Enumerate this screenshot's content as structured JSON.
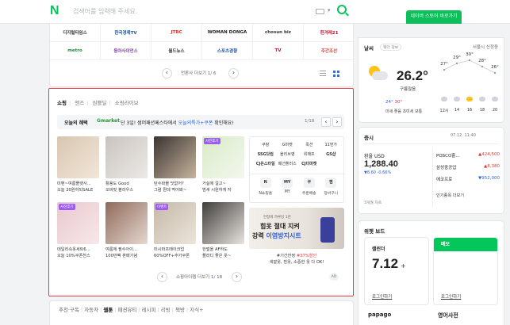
{
  "topbar": {
    "logo": "N",
    "search_placeholder": "검색어를 입력해 주세요.",
    "promo_label": "네이버 스토어 바로가기"
  },
  "press": {
    "rows": [
      [
        "디지털타임스",
        "한국경제TV",
        "JTBC",
        "WOMAN DONGA",
        "chosun biz",
        "한겨레21"
      ],
      [
        "metro",
        "동아사이언스",
        "월드뉴스",
        "스포츠경향",
        "TV",
        "주간조선"
      ]
    ],
    "pager_label": "언론사 더보기",
    "pager_page": "1",
    "pager_total": "/ 6"
  },
  "shopping": {
    "tabs": [
      "쇼핑",
      "맨즈",
      "원쁠딜",
      "쇼핑라이브"
    ],
    "benefit": {
      "label": "오늘의 혜택",
      "brand_prefix": "G",
      "brand": "market",
      "message_pre": "단 3일! 썸머패션페스타에서 ",
      "message_hl": "오늘의특가+쿠폰",
      "message_post": " 확인해요!",
      "counter": "1/18"
    },
    "products": [
      {
        "l1": "미밴~여름플랫사...",
        "l2": "오늘 20원하되SALE",
        "tag": "",
        "c1": "#d9c6b0",
        "c2": "#f1e6da"
      },
      {
        "l1": "활용도 Good",
        "l2": "오버핏 블라우스",
        "tag": "",
        "c1": "#c9c4bf",
        "c2": "#ece9e6"
      },
      {
        "l1": "탄수화물 맛없어?",
        "l2": "그럼 뭔데 먹어봐~",
        "tag": "",
        "c1": "#3a3431",
        "c2": "#c7b49e"
      },
      {
        "l1": "거실에 걸고~",
        "l2": "범새 시원하게 자",
        "tag": "사진후기",
        "c1": "#d8ebc7",
        "c2": "#f4f7ee"
      },
      {
        "l1": "데일리속옷세트6...",
        "l2": "오늘 10%쿠폰찬스",
        "tag": "사진후기",
        "c1": "#e9c8cd",
        "c2": "#f7e8ea"
      },
      {
        "l1": "여름에 필수아이...",
        "l2": "100만팩 판매기념",
        "tag": "",
        "c1": "#8f6a5a",
        "c2": "#e5d8d0"
      },
      {
        "l1": "미시퍼프메이크업",
        "l2": "60%OFF+추가쿠폰",
        "tag": "이벤트",
        "c1": "#c4b8a8",
        "c2": "#ece5db"
      },
      {
        "l1": "한벌을 AF하도",
        "l2": "플라디 좋은 옷~",
        "tag": "",
        "c1": "#3f3d3b",
        "c2": "#e8e4df"
      }
    ],
    "keywords": [
      "쿠팡",
      "G마켓",
      "옥션",
      "11번가",
      "SSG닷컴",
      "올리브영",
      "위메프",
      "GS샵",
      "CJ온스타일",
      "패션플러스",
      "CJ더마켓",
      ""
    ],
    "services": [
      {
        "icon": "N",
        "label": "N쇼핑홈"
      },
      {
        "icon": "MY",
        "label": "MY"
      },
      {
        "icon": "쿠",
        "label": "주문배송"
      },
      {
        "icon": "찜",
        "label": "장바구니"
      }
    ],
    "ad": {
      "small": "한정에 하루당 1번",
      "headline1": "힘옷 절대 지켜",
      "headline2_pre": "강력 ",
      "headline2_hl": "이염방지시트",
      "cap1_pre": "#기간한정 ",
      "cap1_hl": "#37%할인",
      "cap2": "색깔옷, 흰옷, 소중한 옷 다 OK!"
    },
    "pager_label": "쇼핑아이템 더보기",
    "pager_page": "1",
    "pager_total": "/ 18",
    "ad_badge": "AD"
  },
  "content_tabs": [
    "추천·구독",
    "자동차",
    "웹툰",
    "패션뷰티",
    "레시피",
    "리빙",
    "책방",
    "지식+"
  ],
  "weather": {
    "title": "날씨",
    "source": "웨더 정보",
    "location": "서울시 신정동",
    "temp": "26.2°",
    "condition": "구름많음",
    "low": "24°",
    "high": "30°",
    "dust": "미세 좋음 초미세 보통",
    "hours": [
      "12시",
      "14",
      "16",
      "18",
      "20"
    ],
    "hour_temps": [
      27,
      29,
      30,
      28,
      26
    ]
  },
  "stock": {
    "title": "증시",
    "time": "07.12. 11:40",
    "index_name": "환율 USD",
    "index_value": "1,288.40",
    "index_change": "▼8.60 -0.66%",
    "note": "3개월 차트",
    "rows": [
      {
        "name": "POSCO홀...",
        "value": "▲424,500",
        "dir": "up"
      },
      {
        "name": "삼성중공업",
        "value": "▲8,380",
        "dir": "up"
      },
      {
        "name": "에코프로",
        "value": "▼952,000",
        "dir": "dn"
      }
    ],
    "more": "인기종목 더보기"
  },
  "widget": {
    "title": "위젯 보드",
    "calendar_title": "캘린더",
    "calendar_date": "7.12",
    "calendar_plus": "+",
    "calendar_login": "로그인하기",
    "memo_title": "메모",
    "memo_login": "로그인하기",
    "bottom_left": "papago",
    "bottom_right": "영어사전"
  }
}
